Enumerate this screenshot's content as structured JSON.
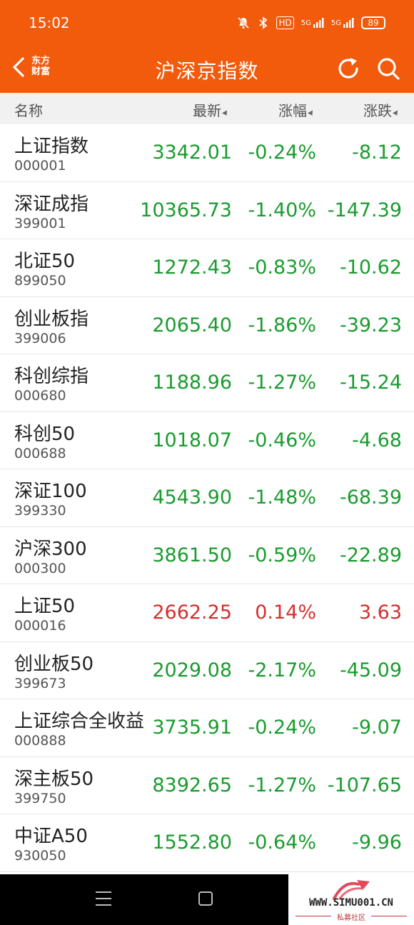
{
  "status_bar": {
    "time": "15:02",
    "icons": [
      "mute-icon",
      "bluetooth-icon",
      "hd-icon",
      "signal-5g-icon",
      "signal-5g-icon"
    ],
    "hd_label": "HD",
    "net1_label": "5G",
    "net2_label": "5G",
    "battery": "89"
  },
  "nav": {
    "logo_line1": "东方",
    "logo_line2": "财富",
    "title": "沪深京指数"
  },
  "columns": {
    "name": "名称",
    "latest": "最新",
    "pct": "涨幅",
    "chg": "涨跌"
  },
  "colors": {
    "brand": "#f25a0c",
    "down": "#1a9c2f",
    "up": "#d43030"
  },
  "rows": [
    {
      "name": "上证指数",
      "code": "000001",
      "latest": "3342.01",
      "pct": "-0.24%",
      "chg": "-8.12",
      "trend": "down"
    },
    {
      "name": "深证成指",
      "code": "399001",
      "latest": "10365.73",
      "pct": "-1.40%",
      "chg": "-147.39",
      "trend": "down"
    },
    {
      "name": "北证50",
      "code": "899050",
      "latest": "1272.43",
      "pct": "-0.83%",
      "chg": "-10.62",
      "trend": "down"
    },
    {
      "name": "创业板指",
      "code": "399006",
      "latest": "2065.40",
      "pct": "-1.86%",
      "chg": "-39.23",
      "trend": "down"
    },
    {
      "name": "科创综指",
      "code": "000680",
      "latest": "1188.96",
      "pct": "-1.27%",
      "chg": "-15.24",
      "trend": "down"
    },
    {
      "name": "科创50",
      "code": "000688",
      "latest": "1018.07",
      "pct": "-0.46%",
      "chg": "-4.68",
      "trend": "down"
    },
    {
      "name": "深证100",
      "code": "399330",
      "latest": "4543.90",
      "pct": "-1.48%",
      "chg": "-68.39",
      "trend": "down"
    },
    {
      "name": "沪深300",
      "code": "000300",
      "latest": "3861.50",
      "pct": "-0.59%",
      "chg": "-22.89",
      "trend": "down"
    },
    {
      "name": "上证50",
      "code": "000016",
      "latest": "2662.25",
      "pct": "0.14%",
      "chg": "3.63",
      "trend": "up"
    },
    {
      "name": "创业板50",
      "code": "399673",
      "latest": "2029.08",
      "pct": "-2.17%",
      "chg": "-45.09",
      "trend": "down"
    },
    {
      "name": "上证综合全收益",
      "code": "000888",
      "latest": "3735.91",
      "pct": "-0.24%",
      "chg": "-9.07",
      "trend": "down"
    },
    {
      "name": "深主板50",
      "code": "399750",
      "latest": "8392.65",
      "pct": "-1.27%",
      "chg": "-107.65",
      "trend": "down"
    },
    {
      "name": "中证A50",
      "code": "930050",
      "latest": "1552.80",
      "pct": "-0.64%",
      "chg": "-9.96",
      "trend": "down"
    }
  ],
  "watermark": {
    "site": "WWW.SIMU001.CN",
    "sub": "私募社区"
  }
}
